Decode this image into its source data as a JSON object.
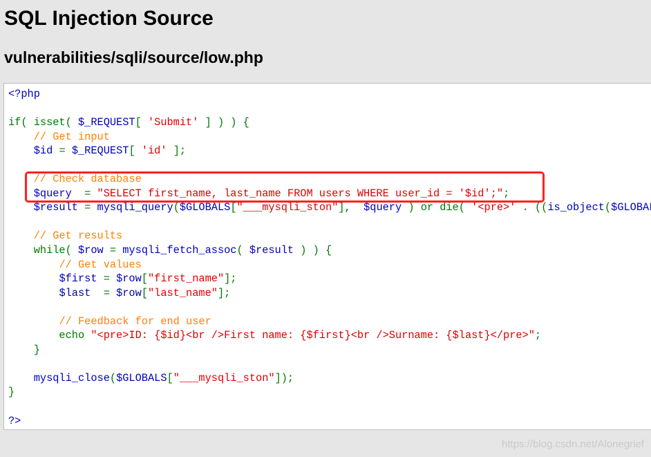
{
  "page": {
    "title": "SQL Injection Source",
    "subtitle": "vulnerabilities/sqli/source/low.php"
  },
  "code_lines": [
    [
      {
        "t": "<?php",
        "c": "vr"
      }
    ],
    [],
    [
      {
        "t": "if( isset( ",
        "c": "kw"
      },
      {
        "t": "$_REQUEST",
        "c": "vr"
      },
      {
        "t": "[ ",
        "c": "kw"
      },
      {
        "t": "'Submit'",
        "c": "st"
      },
      {
        "t": " ] ) ) {",
        "c": "kw"
      }
    ],
    [
      {
        "t": "    ",
        "c": "kw"
      },
      {
        "t": "// Get input",
        "c": "cm"
      }
    ],
    [
      {
        "t": "    ",
        "c": "kw"
      },
      {
        "t": "$id",
        "c": "vr"
      },
      {
        "t": " = ",
        "c": "kw"
      },
      {
        "t": "$_REQUEST",
        "c": "vr"
      },
      {
        "t": "[ ",
        "c": "kw"
      },
      {
        "t": "'id'",
        "c": "st"
      },
      {
        "t": " ];",
        "c": "kw"
      }
    ],
    [],
    [
      {
        "t": "    ",
        "c": "kw"
      },
      {
        "t": "// Check database",
        "c": "cm"
      }
    ],
    [
      {
        "t": "    ",
        "c": "kw"
      },
      {
        "t": "$query",
        "c": "vr"
      },
      {
        "t": "  = ",
        "c": "kw"
      },
      {
        "t": "\"SELECT first_name, last_name FROM users WHERE user_id = '$id';\"",
        "c": "st"
      },
      {
        "t": ";",
        "c": "kw"
      }
    ],
    [
      {
        "t": "    ",
        "c": "kw"
      },
      {
        "t": "$result",
        "c": "vr"
      },
      {
        "t": " = ",
        "c": "kw"
      },
      {
        "t": "mysqli_query",
        "c": "vr"
      },
      {
        "t": "(",
        "c": "kw"
      },
      {
        "t": "$GLOBALS",
        "c": "vr"
      },
      {
        "t": "[",
        "c": "kw"
      },
      {
        "t": "\"___mysqli_ston\"",
        "c": "st"
      },
      {
        "t": "],  ",
        "c": "kw"
      },
      {
        "t": "$query",
        "c": "vr"
      },
      {
        "t": " ) or die( ",
        "c": "kw"
      },
      {
        "t": "'<pre>'",
        "c": "st"
      },
      {
        "t": " . ((",
        "c": "kw"
      },
      {
        "t": "is_object",
        "c": "vr"
      },
      {
        "t": "(",
        "c": "kw"
      },
      {
        "t": "$GLOBALS",
        "c": "vr"
      }
    ],
    [],
    [
      {
        "t": "    ",
        "c": "kw"
      },
      {
        "t": "// Get results",
        "c": "cm"
      }
    ],
    [
      {
        "t": "    while( ",
        "c": "kw"
      },
      {
        "t": "$row",
        "c": "vr"
      },
      {
        "t": " = ",
        "c": "kw"
      },
      {
        "t": "mysqli_fetch_assoc",
        "c": "vr"
      },
      {
        "t": "( ",
        "c": "kw"
      },
      {
        "t": "$result",
        "c": "vr"
      },
      {
        "t": " ) ) {",
        "c": "kw"
      }
    ],
    [
      {
        "t": "        ",
        "c": "kw"
      },
      {
        "t": "// Get values",
        "c": "cm"
      }
    ],
    [
      {
        "t": "        ",
        "c": "kw"
      },
      {
        "t": "$first",
        "c": "vr"
      },
      {
        "t": " = ",
        "c": "kw"
      },
      {
        "t": "$row",
        "c": "vr"
      },
      {
        "t": "[",
        "c": "kw"
      },
      {
        "t": "\"first_name\"",
        "c": "st"
      },
      {
        "t": "];",
        "c": "kw"
      }
    ],
    [
      {
        "t": "        ",
        "c": "kw"
      },
      {
        "t": "$last",
        "c": "vr"
      },
      {
        "t": "  = ",
        "c": "kw"
      },
      {
        "t": "$row",
        "c": "vr"
      },
      {
        "t": "[",
        "c": "kw"
      },
      {
        "t": "\"last_name\"",
        "c": "st"
      },
      {
        "t": "];",
        "c": "kw"
      }
    ],
    [],
    [
      {
        "t": "        ",
        "c": "kw"
      },
      {
        "t": "// Feedback for end user",
        "c": "cm"
      }
    ],
    [
      {
        "t": "        echo ",
        "c": "kw"
      },
      {
        "t": "\"<pre>ID: {$id}<br />First name: {$first}<br />Surname: {$last}</pre>\"",
        "c": "st"
      },
      {
        "t": ";",
        "c": "kw"
      }
    ],
    [
      {
        "t": "    }",
        "c": "kw"
      }
    ],
    [],
    [
      {
        "t": "    ",
        "c": "kw"
      },
      {
        "t": "mysqli_close",
        "c": "vr"
      },
      {
        "t": "(",
        "c": "kw"
      },
      {
        "t": "$GLOBALS",
        "c": "vr"
      },
      {
        "t": "[",
        "c": "kw"
      },
      {
        "t": "\"___mysqli_ston\"",
        "c": "st"
      },
      {
        "t": "]);",
        "c": "kw"
      }
    ],
    [
      {
        "t": "}",
        "c": "kw"
      }
    ],
    [],
    [
      {
        "t": "?>",
        "c": "vr"
      }
    ]
  ],
  "highlight_color": "#ff1f1f",
  "watermark": "https://blog.csdn.net/Alonegrief"
}
